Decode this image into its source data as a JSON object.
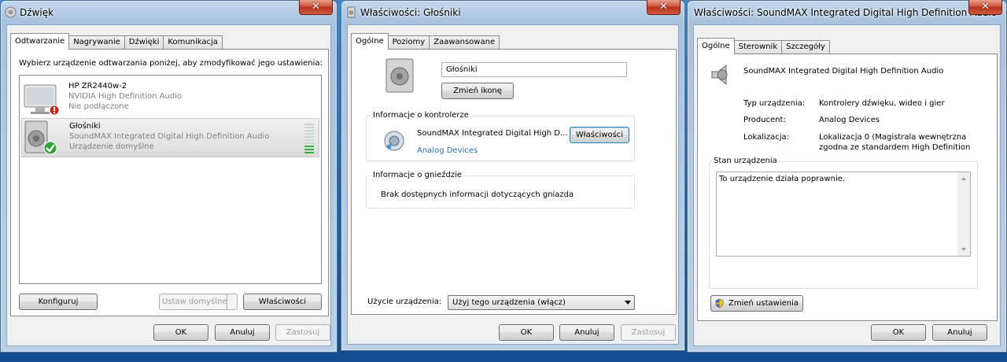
{
  "sound_dialog": {
    "title": "Dźwięk",
    "tabs": [
      "Odtwarzanie",
      "Nagrywanie",
      "Dźwięki",
      "Komunikacja"
    ],
    "instruction": "Wybierz urządzenie odtwarzania poniżej, aby zmodyfikować jego ustawienia:",
    "devices": [
      {
        "name": "HP ZR2440w-2",
        "driver": "NVIDIA High Definition Audio",
        "status": "Nie podłączone",
        "icon": "monitor-speaker-icon",
        "badge": "disconnected-badge-icon"
      },
      {
        "name": "Głośniki",
        "driver": "SoundMAX Integrated Digital High Definition Audio",
        "status": "Urządzenie domyślne",
        "icon": "speaker-icon",
        "badge": "default-check-icon",
        "level_fraction": 0.25
      }
    ],
    "configure_label": "Konfiguruj",
    "set_default_label": "Ustaw domyślne",
    "properties_label": "Właściwości",
    "ok_label": "OK",
    "cancel_label": "Anuluj",
    "apply_label": "Zastosuj"
  },
  "speaker_props": {
    "title": "Właściwości: Głośniki",
    "tabs": [
      "Ogólne",
      "Poziomy",
      "Zaawansowane"
    ],
    "device_name": "Głośniki",
    "change_icon_label": "Zmień ikonę",
    "controller_group_label": "Informacje o kontrolerze",
    "controller_name": "SoundMAX Integrated Digital High D...",
    "controller_vendor": "Analog Devices",
    "controller_props_label": "Właściwości",
    "jack_group_label": "Informacje o gnieździe",
    "jack_info": "Brak dostępnych informacji dotyczących gniazda",
    "usage_label": "Użycie urządzenia:",
    "usage_value": "Użyj tego urządzenia (włącz)",
    "ok_label": "OK",
    "cancel_label": "Anuluj",
    "apply_label": "Zastosuj"
  },
  "soundmax_props": {
    "title": "Właściwości: SoundMAX Integrated Digital High Definition Audio",
    "tabs": [
      "Ogólne",
      "Sterownik",
      "Szczegóły"
    ],
    "device_name": "SoundMAX Integrated Digital High Definition Audio",
    "fields": [
      {
        "label": "Typ urządzenia:",
        "value": "Kontrolery dźwięku, wideo i gier"
      },
      {
        "label": "Producent:",
        "value": "Analog Devices"
      },
      {
        "label": "Lokalizacja:",
        "value": "Lokalizacja 0 (Magistrala wewnętrzna",
        "value2": "zgodna ze standardem High Definition"
      }
    ],
    "status_group_label": "Stan urządzenia",
    "status_text": "To urządzenie działa poprawnie.",
    "change_settings_label": "Zmień ustawienia",
    "ok_label": "OK",
    "cancel_label": "Anuluj"
  }
}
